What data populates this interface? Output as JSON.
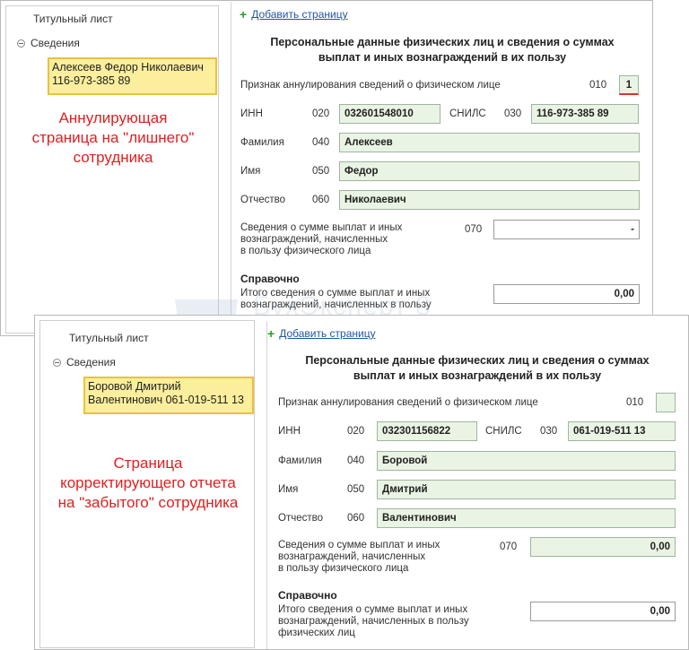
{
  "top": {
    "tree": {
      "title": "Титульный лист",
      "node": "Сведения",
      "employee_line1": "Алексеев Федор Николаевич",
      "employee_line2": "116-973-385 89"
    },
    "note": [
      "Аннулирующая",
      "страница на \"лишнего\"",
      "сотрудника"
    ],
    "form": {
      "add_page": "Добавить страницу",
      "heading1": "Персональные данные физических лиц и сведения о суммах",
      "heading2": "выплат и иных вознаграждений в их пользу",
      "cancel_label": "Признак аннулирования сведений о физическом лице",
      "cancel_code": "010",
      "cancel_value": "1",
      "inn_label": "ИНН",
      "inn_code": "020",
      "inn_value": "032601548010",
      "snils_label": "СНИЛС",
      "snils_code": "030",
      "snils_value": "116-973-385 89",
      "surname_label": "Фамилия",
      "surname_code": "040",
      "surname_value": "Алексеев",
      "name_label": "Имя",
      "name_code": "050",
      "name_value": "Федор",
      "patronymic_label": "Отчество",
      "patronymic_code": "060",
      "patronymic_value": "Николаевич",
      "payments_label1": "Сведения о сумме выплат и иных",
      "payments_label2": "вознаграждений, начисленных",
      "payments_label3": "в пользу физического лица",
      "payments_code": "070",
      "payments_value": "-",
      "reference_label": "Справочно",
      "total_label1": "Итого сведения о сумме выплат и иных",
      "total_label2": "вознаграждений, начисленных в пользу",
      "total_value": "0,00"
    }
  },
  "bottom": {
    "tree": {
      "title": "Титульный лист",
      "node": "Сведения",
      "employee_line1": "Боровой Дмитрий",
      "employee_line2": "Валентинович 061-019-511 13"
    },
    "note": [
      "Страница",
      "корректирующего отчета",
      "на \"забытого\" сотрудника"
    ],
    "form": {
      "add_page": "Добавить страницу",
      "heading1": "Персональные данные физических лиц и сведения о суммах",
      "heading2": "выплат и иных вознаграждений в их пользу",
      "cancel_label": "Признак аннулирования сведений о физическом лице",
      "cancel_code": "010",
      "cancel_value": "",
      "inn_label": "ИНН",
      "inn_code": "020",
      "inn_value": "032301156822",
      "snils_label": "СНИЛС",
      "snils_code": "030",
      "snils_value": "061-019-511 13",
      "surname_label": "Фамилия",
      "surname_code": "040",
      "surname_value": "Боровой",
      "name_label": "Имя",
      "name_code": "050",
      "name_value": "Дмитрий",
      "patronymic_label": "Отчество",
      "patronymic_code": "060",
      "patronymic_value": "Валентинович",
      "payments_label1": "Сведения о сумме выплат и иных",
      "payments_label2": "вознаграждений, начисленных",
      "payments_label3": "в пользу физического лица",
      "payments_code": "070",
      "payments_value": "0,00",
      "reference_label": "Справочно",
      "total_label1": "Итого сведения о сумме выплат и иных",
      "total_label2": "вознаграждений, начисленных в пользу",
      "total_label3": "физических лиц",
      "total_value": "0,00"
    }
  },
  "watermark": {
    "brand": "БухЭксперт 8",
    "tagline": "База ответов по учёту в 1С"
  }
}
